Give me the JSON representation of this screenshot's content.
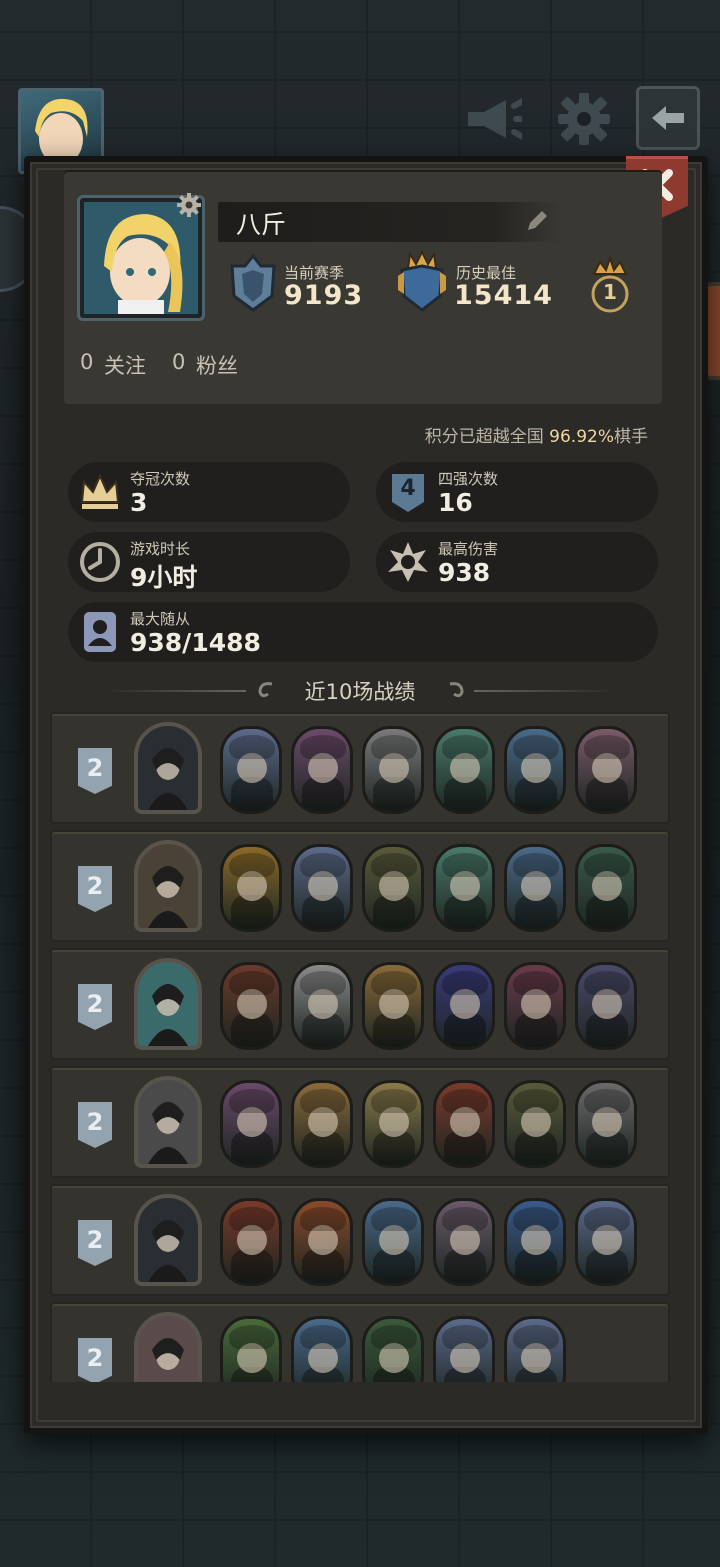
{
  "header": {
    "sound_icon": "megaphone-icon",
    "settings_icon": "gear-icon",
    "back_icon": "back-arrow-icon"
  },
  "profile": {
    "name": "八斤",
    "current_season_label": "当前赛季",
    "current_season_value": "9193",
    "history_best_label": "历史最佳",
    "history_best_value": "15414",
    "crown_rank": "1",
    "follow_count": "0",
    "follow_label": "关注",
    "fans_count": "0",
    "fans_label": "粉丝"
  },
  "percentile": {
    "prefix": "积分已超越全国 ",
    "value": "96.92%",
    "suffix": "棋手"
  },
  "stats": {
    "champion": {
      "label": "夺冠次数",
      "value": "3"
    },
    "top4": {
      "label": "四强次数",
      "value": "16",
      "icon_text": "4"
    },
    "playtime": {
      "label": "游戏时长",
      "value": "9小时"
    },
    "max_damage": {
      "label": "最高伤害",
      "value": "938"
    },
    "max_followers": {
      "label": "最大随从",
      "value": "938/1488"
    }
  },
  "recent": {
    "title": "近10场战绩",
    "rows": [
      {
        "place": "2",
        "hero": "#2a2d31",
        "units": [
          "#5b6a8a",
          "#6a4a6a",
          "#7a7a7a",
          "#4a7a6a",
          "#4a6a8a",
          "#7a5a6a"
        ]
      },
      {
        "place": "2",
        "hero": "#4a4236",
        "units": [
          "#8a6a2a",
          "#5b6a8a",
          "#5a5a3a",
          "#4a7a6a",
          "#4a6a8a",
          "#3a5a4a"
        ]
      },
      {
        "place": "2",
        "hero": "#3a6a6a",
        "units": [
          "#6a3a2a",
          "#8a8a8a",
          "#8a6a3a",
          "#3a3a7a",
          "#6a3a4a",
          "#4a4a6a"
        ]
      },
      {
        "place": "2",
        "hero": "#4a4a4a",
        "units": [
          "#6a4a6a",
          "#8a6a3a",
          "#8a7a4a",
          "#7a3a2a",
          "#5a5a3a",
          "#6a6a6a"
        ]
      },
      {
        "place": "2",
        "hero": "#2a2d31",
        "units": [
          "#7a3a2a",
          "#8a4a2a",
          "#4a6a8a",
          "#6a5a6a",
          "#3a5a8a",
          "#5b6a8a"
        ]
      },
      {
        "place": "2",
        "hero": "#5a4a4a",
        "units": [
          "#4a6a3a",
          "#4a6a8a",
          "#3a5a3a",
          "#5a6a8a",
          "#5b6a8a"
        ]
      }
    ]
  },
  "colors": {
    "accent_gold": "#f0d7a2",
    "panel": "#2b2a27",
    "close_red": "#8e3a2e"
  }
}
